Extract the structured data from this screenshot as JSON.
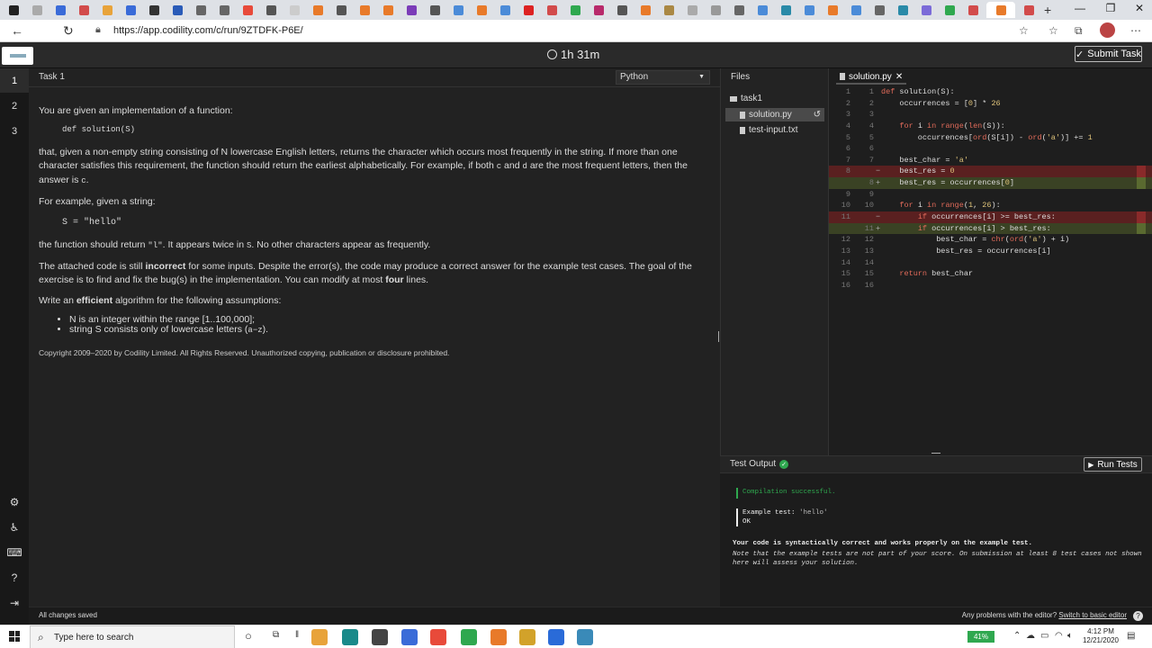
{
  "browser": {
    "url": "https://app.codility.com/c/run/9ZTDFK-P6E/",
    "tab_favicon_colors": [
      "#222",
      "#aaa",
      "#3a6bd8",
      "#d24b4b",
      "#e8a33a",
      "#3a6bd8",
      "#333",
      "#2a5bb8",
      "#666",
      "#666",
      "#e84a3a",
      "#555",
      "#ccc",
      "#e87a2a",
      "#555",
      "#e87a2a",
      "#e87a2a",
      "#7b3cb8",
      "#555",
      "#4b8bd8",
      "#e87a2a",
      "#4b8bd8",
      "#d22",
      "#d24b4b",
      "#2fa84f",
      "#b82a6b",
      "#555",
      "#e87a2a",
      "#a84",
      "#aaa",
      "#999",
      "#666",
      "#4b8bd8",
      "#2a8aa8",
      "#4b8bd8",
      "#e87a2a",
      "#4b8bd8",
      "#666",
      "#2a8aa8",
      "#7b6bd8",
      "#2fa84f",
      "#d24b4b",
      "#e87a2a",
      "#d24b4b"
    ]
  },
  "header": {
    "timer": "1h 31m",
    "submit_label": "Submit Task"
  },
  "rail": {
    "tasks": [
      "1",
      "2",
      "3"
    ]
  },
  "task": {
    "title": "Task 1",
    "language": "Python",
    "intro": "You are given an implementation of a function:",
    "signature": "def solution(S)",
    "desc_a": "that, given a non-empty string consisting of N lowercase English letters, returns the character which occurs most frequently in the string. If more than one character satisfies this requirement, the function should return the earliest alphabetically. For example, if both ",
    "code_c": "c",
    "desc_and": " and ",
    "code_d": "d",
    "desc_b": " are the most frequent letters, then the answer is ",
    "desc_end": ".",
    "example_intro": "For example, given a string:",
    "example_code": "S = \"hello\"",
    "return_a": "the function should return ",
    "return_val": "\"l\"",
    "return_b": ". It appears twice in ",
    "return_s": "S",
    "return_c": ". No other characters appear as frequently.",
    "attached_a": "The attached code is still ",
    "attached_bold": "incorrect",
    "attached_b": " for some inputs. Despite the error(s), the code may produce a correct answer for the example test cases. The goal of the exercise is to find and fix the bug(s) in the implementation. You can modify at most ",
    "attached_four": "four",
    "attached_c": " lines.",
    "efficient_a": "Write an ",
    "efficient_bold": "efficient",
    "efficient_b": " algorithm for the following assumptions:",
    "assumption_1": "N is an integer within the range [1..100,000];",
    "assumption_2a": "string S consists only of lowercase letters (",
    "assumption_2code": "a−z",
    "assumption_2b": ").",
    "copyright": "Copyright 2009–2020 by Codility Limited. All Rights Reserved. Unauthorized copying, publication or disclosure prohibited."
  },
  "files": {
    "title": "Files",
    "folder": "task1",
    "file_1": "solution.py",
    "file_2": "test-input.txt"
  },
  "editor": {
    "tab_label": "solution.py",
    "lines": [
      {
        "n1": "1",
        "n2": "1",
        "type": "",
        "marker": "",
        "html": "<span class='kw'>def</span> solution(S):"
      },
      {
        "n1": "2",
        "n2": "2",
        "type": "",
        "marker": "",
        "html": "    occurrences = [<span class='num'>0</span>] * <span class='num'>26</span>"
      },
      {
        "n1": "3",
        "n2": "3",
        "type": "",
        "marker": "",
        "html": ""
      },
      {
        "n1": "4",
        "n2": "4",
        "type": "",
        "marker": "",
        "html": "    <span class='kw'>for</span> i <span class='kw'>in</span> <span class='fn'>range</span>(<span class='fn'>len</span>(S)):"
      },
      {
        "n1": "5",
        "n2": "5",
        "type": "",
        "marker": "",
        "html": "        occurrences[<span class='fn'>ord</span>(S[i]) - <span class='fn'>ord</span>(<span class='str'>'a'</span>)] += <span class='num'>1</span>"
      },
      {
        "n1": "6",
        "n2": "6",
        "type": "",
        "marker": "",
        "html": ""
      },
      {
        "n1": "7",
        "n2": "7",
        "type": "",
        "marker": "",
        "html": "    best_char = <span class='str'>'a'</span>"
      },
      {
        "n1": "8",
        "n2": "",
        "type": "del",
        "marker": "−",
        "html": "    best_res = <span class='num'>0</span>"
      },
      {
        "n1": "",
        "n2": "8",
        "type": "add",
        "marker": "+",
        "html": "    best_res = occurrences[<span class='num'>0</span>]"
      },
      {
        "n1": "9",
        "n2": "9",
        "type": "",
        "marker": "",
        "html": ""
      },
      {
        "n1": "10",
        "n2": "10",
        "type": "",
        "marker": "",
        "html": "    <span class='kw'>for</span> i <span class='kw'>in</span> <span class='fn'>range</span>(<span class='num'>1</span>, <span class='num'>26</span>):"
      },
      {
        "n1": "11",
        "n2": "",
        "type": "del",
        "marker": "−",
        "html": "        <span class='kw'>if</span> occurrences[i] &gt;= best_res:"
      },
      {
        "n1": "",
        "n2": "11",
        "type": "add",
        "marker": "+",
        "html": "        <span class='kw'>if</span> occurrences[i] &gt; best_res:"
      },
      {
        "n1": "12",
        "n2": "12",
        "type": "",
        "marker": "",
        "html": "            best_char = <span class='fn'>chr</span>(<span class='fn'>ord</span>(<span class='str'>'a'</span>) + i)"
      },
      {
        "n1": "13",
        "n2": "13",
        "type": "",
        "marker": "",
        "html": "            best_res = occurrences[i]"
      },
      {
        "n1": "14",
        "n2": "14",
        "type": "",
        "marker": "",
        "html": ""
      },
      {
        "n1": "15",
        "n2": "15",
        "type": "",
        "marker": "",
        "html": "    <span class='kw'>return</span> best_char"
      },
      {
        "n1": "16",
        "n2": "16",
        "type": "",
        "marker": "",
        "html": ""
      }
    ]
  },
  "test_output": {
    "title": "Test Output",
    "run_label": "Run Tests",
    "compile": "Compilation successful.",
    "example_label": "Example test:",
    "example_value": "'hello'",
    "example_result": "OK",
    "summary": "Your code is syntactically correct and works properly on the example test.",
    "note": "Note that the example tests are not part of your score. On submission at least 8 test cases not shown here will assess your solution."
  },
  "status": {
    "saved": "All changes saved",
    "problems": "Any problems with the editor?",
    "switch_link": "Switch to basic editor"
  },
  "taskbar": {
    "search_placeholder": "Type here to search",
    "battery": "41%",
    "time": "4:12 PM",
    "date": "12/21/2020",
    "app_colors": [
      "#e8a33a",
      "#1a8a8a",
      "#444",
      "#3a6bd8",
      "#e84a3a",
      "#2fa84f",
      "#e87a2a",
      "#d2a22a",
      "#2a6bd8",
      "#3a8ab8"
    ]
  }
}
